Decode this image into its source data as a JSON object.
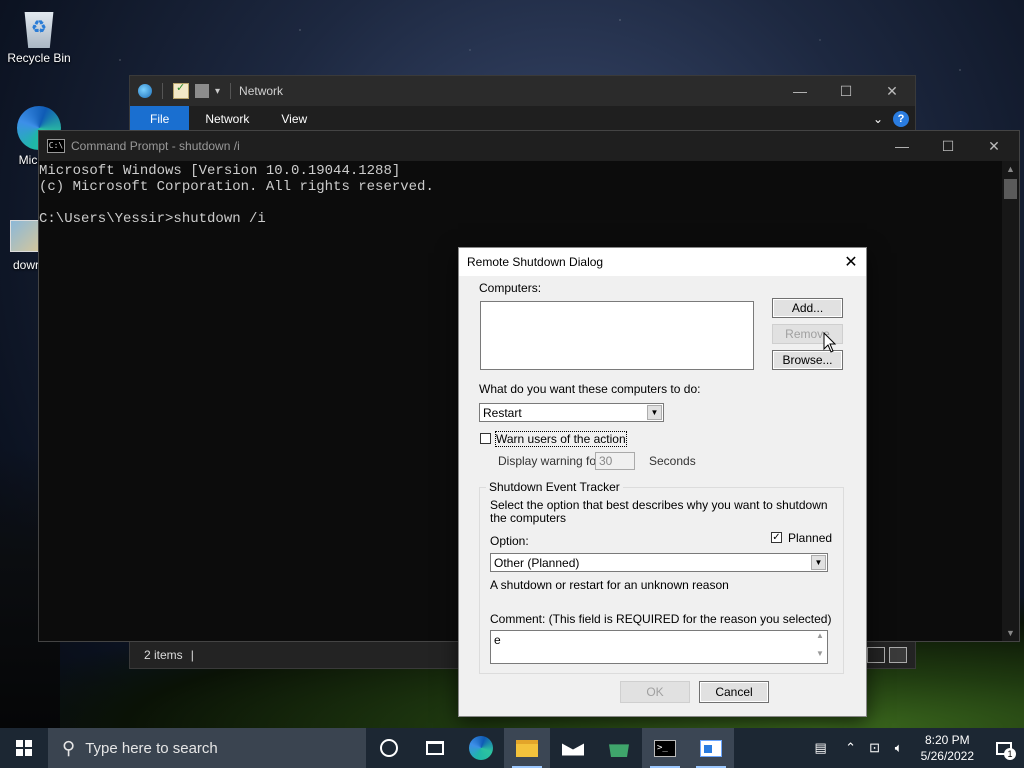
{
  "desktop": {
    "icons": [
      {
        "label": "Recycle Bin"
      },
      {
        "label": "Micr Ed"
      },
      {
        "label": "dowr"
      }
    ]
  },
  "explorer": {
    "title": "Network",
    "tabs": [
      "File",
      "Network",
      "View"
    ],
    "status": "2 items",
    "status_cursor": "|"
  },
  "cmd": {
    "title": "Command Prompt - shutdown  /i",
    "lines": [
      "Microsoft Windows [Version 10.0.19044.1288]",
      "(c) Microsoft Corporation. All rights reserved.",
      "",
      "C:\\Users\\Yessir>shutdown /i"
    ]
  },
  "dialog": {
    "title": "Remote Shutdown Dialog",
    "computers_label": "Computers:",
    "add_button": "Add...",
    "remove_button": "Remove",
    "browse_button": "Browse...",
    "action_label": "What do you want these computers to do:",
    "action_value": "Restart",
    "warn_label": "Warn users of the action",
    "warn_checked": false,
    "display_warning_label": "Display warning for",
    "warning_seconds": "30",
    "seconds_label": "Seconds",
    "tracker_legend": "Shutdown Event Tracker",
    "tracker_desc": "Select the option that best describes why you want to shutdown the computers",
    "option_label": "Option:",
    "planned_label": "Planned",
    "planned_checked": true,
    "option_value": "Other (Planned)",
    "option_desc": "A shutdown or restart for an unknown reason",
    "comment_label": "Comment: (This field is REQUIRED for the reason you selected)",
    "comment_value": "e",
    "ok_button": "OK",
    "cancel_button": "Cancel"
  },
  "taskbar": {
    "search_placeholder": "Type here to search",
    "time": "8:20 PM",
    "date": "5/26/2022",
    "notification_count": "1"
  }
}
